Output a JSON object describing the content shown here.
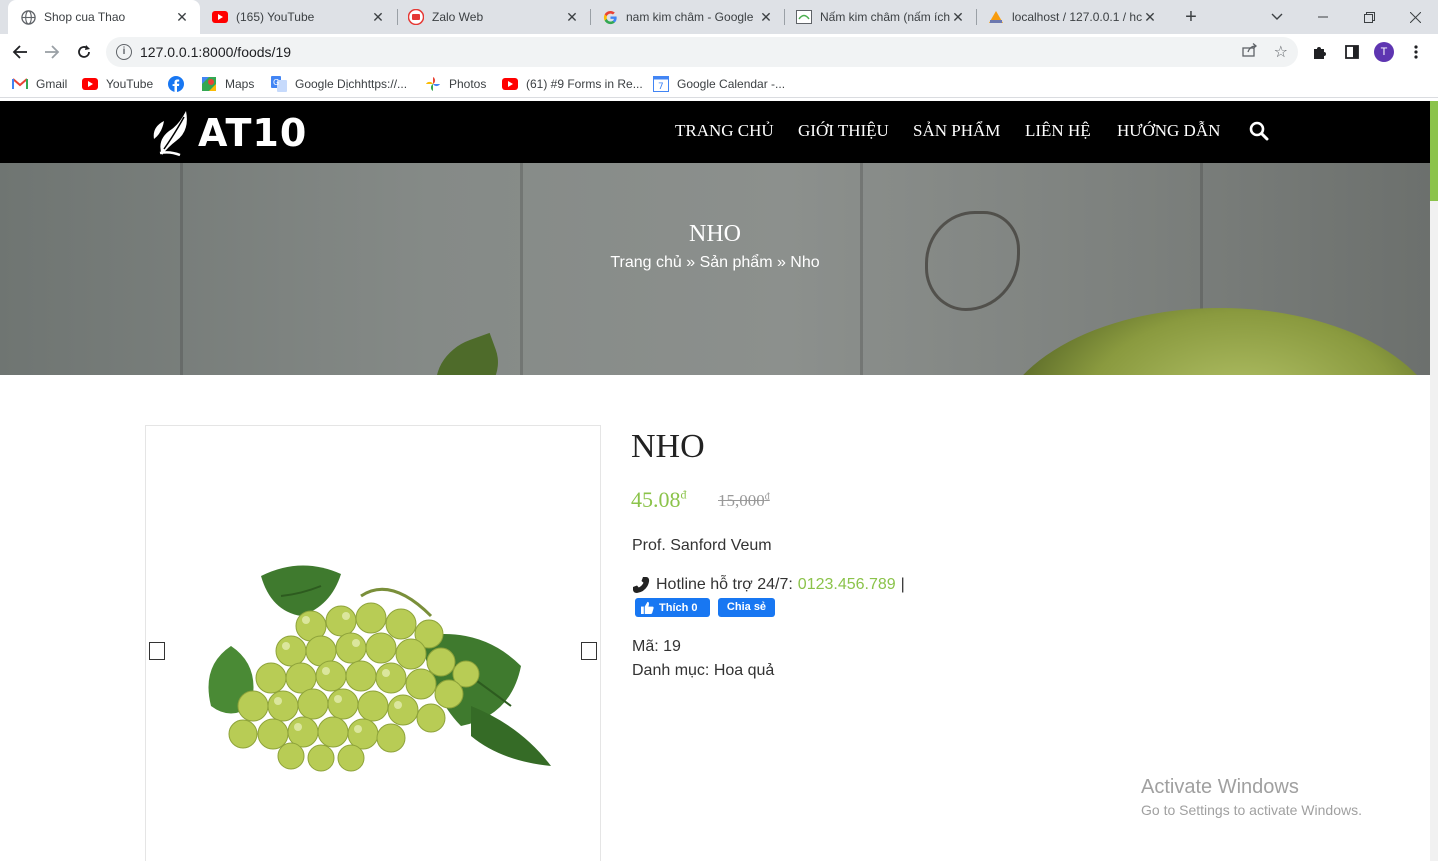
{
  "browser": {
    "tabs": [
      {
        "title": "Shop cua Thao",
        "icon": "globe-icon",
        "active": true
      },
      {
        "title": "(165) YouTube",
        "icon": "youtube-icon"
      },
      {
        "title": "Zalo Web",
        "icon": "zalo-icon"
      },
      {
        "title": "nam kim châm - Google",
        "icon": "google-icon"
      },
      {
        "title": "Nấm kim châm (nấm ích",
        "icon": "mushroom-site-icon"
      },
      {
        "title": "localhost / 127.0.0.1 / hc",
        "icon": "phpmyadmin-icon"
      }
    ],
    "url": "127.0.0.1:8000/foods/19",
    "avatar_letter": "T",
    "bookmarks": [
      {
        "label": "Gmail",
        "icon": "gmail-icon"
      },
      {
        "label": "YouTube",
        "icon": "youtube-icon"
      },
      {
        "label": "",
        "icon": "facebook-icon"
      },
      {
        "label": "Maps",
        "icon": "maps-icon"
      },
      {
        "label": "Google Dịchhttps://...",
        "icon": "google-translate-icon"
      },
      {
        "label": "Photos",
        "icon": "photos-icon"
      },
      {
        "label": "(61) #9 Forms in Re...",
        "icon": "youtube-icon"
      },
      {
        "label": "Google Calendar -...",
        "icon": "calendar-icon"
      }
    ]
  },
  "site": {
    "logo": "AT10",
    "nav": [
      "TRANG CHỦ",
      "GIỚI THIỆU",
      "SẢN PHẨM",
      "LIÊN HỆ",
      "HƯỚNG DẪN"
    ],
    "accent_color": "#8bc34a"
  },
  "hero": {
    "title": "NHO",
    "breadcrumb": "Trang chủ » Sản phẩm » Nho"
  },
  "product": {
    "name": "NHO",
    "price": "45.08",
    "old_price": "15,000",
    "currency": "đ",
    "author": "Prof. Sanford Veum",
    "hotline_label": "Hotline hỗ trợ 24/7:",
    "hotline_number": "0123.456.789",
    "hotline_sep": "|",
    "like_label": "Thích 0",
    "share_label": "Chia sẻ",
    "code_line": "Mã: 19",
    "category_line": "Danh mục: Hoa quả"
  },
  "watermark": {
    "title": "Activate Windows",
    "subtitle": "Go to Settings to activate Windows."
  }
}
